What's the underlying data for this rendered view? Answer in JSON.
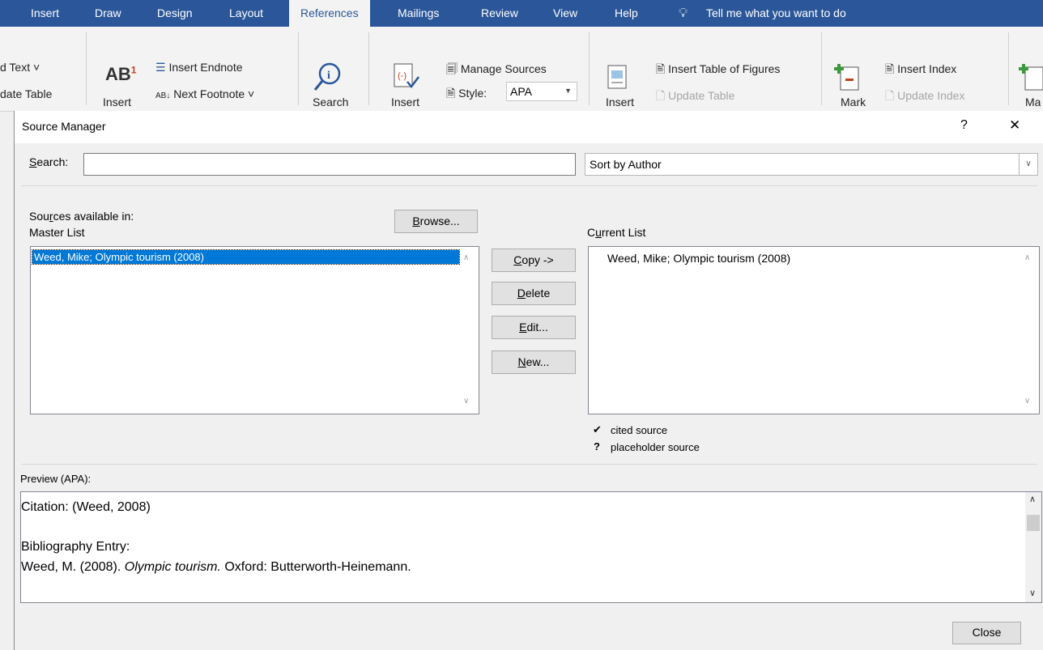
{
  "ribbon": {
    "tabs": [
      "Insert",
      "Draw",
      "Design",
      "Layout",
      "References",
      "Mailings",
      "Review",
      "View",
      "Help"
    ],
    "tell_me": "Tell me what you want to do",
    "add_text": "d Text",
    "update_table": "date Table",
    "insert_footnote": "Insert",
    "insert_endnote": "Insert Endnote",
    "next_footnote": "Next Footnote",
    "search": "Search",
    "insert_citation": "Insert",
    "manage_sources": "Manage Sources",
    "style_label": "Style:",
    "style_value": "APA",
    "insert_caption": "Insert",
    "insert_table_of_figures": "Insert Table of Figures",
    "update_table2": "Update Table",
    "mark_entry": "Mark",
    "insert_index": "Insert Index",
    "update_index": "Update Index",
    "mark_citation": "Ma"
  },
  "dialog": {
    "title": "Source Manager",
    "help": "?",
    "close_x": "✕",
    "search_label": "Search:",
    "search_value": "",
    "sort_value": "Sort by Author",
    "sources_available_label": "Sources available in:",
    "master_list_label": "Master List",
    "browse_label": "Browse...",
    "current_list_label": "Current List",
    "master_list": [
      "Weed, Mike; Olympic tourism (2008)"
    ],
    "current_list": [
      "Weed, Mike; Olympic tourism (2008)"
    ],
    "copy_label": "Copy ->",
    "delete_label": "Delete",
    "edit_label": "Edit...",
    "new_label": "New...",
    "legend_cited_mark": "✔",
    "legend_cited": "cited source",
    "legend_placeholder_mark": "?",
    "legend_placeholder": "placeholder source",
    "preview_label": "Preview (APA):",
    "preview_citation": "Citation:  (Weed, 2008)",
    "preview_bib_heading": "Bibliography Entry:",
    "preview_bib_author": "Weed, M. (2008).",
    "preview_bib_title": "Olympic tourism.",
    "preview_bib_rest": "Oxford: Butterworth-Heinemann.",
    "close_button": "Close"
  },
  "colors": {
    "ribbon_blue": "#2b579a",
    "selection": "#0078d7"
  }
}
